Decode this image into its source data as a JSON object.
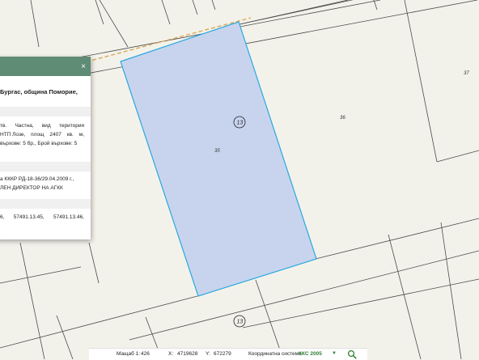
{
  "map": {
    "parcel_labels": [
      {
        "id": "parcel-35",
        "text": "35"
      },
      {
        "id": "parcel-36",
        "text": "36"
      },
      {
        "id": "parcel-37",
        "text": "37"
      }
    ],
    "circle_labels": [
      {
        "id": "upper",
        "text": "13"
      },
      {
        "id": "lower",
        "text": "13"
      }
    ],
    "colors": {
      "background": "#f3f2ea",
      "boundary": "#4a4a4a",
      "selected_fill": "#c8d4ee",
      "selected_stroke": "#29a8e0",
      "road_dash": "#d9a85a"
    }
  },
  "popup": {
    "close_label": "×",
    "address_line1": "Бургас, община Поморие,",
    "desc_line1": [
      "тв.",
      "Частна,",
      "вид",
      "територия"
    ],
    "desc_line2": [
      "НТП Лозе,",
      "площ",
      "2407",
      "кв.",
      "м,"
    ],
    "desc_line3": "върхове: 5 бр., Брой върхове: 5",
    "order_line1": "а КККР РД-18-36/29.04.2009 г.,",
    "order_line2": "ЛЕН ДИРЕКТОР НА АГКК",
    "neighbors_line": [
      "6,",
      "57491.13.45,",
      "57491.13.46,"
    ]
  },
  "bottom_bar": {
    "scale_label": "Мащаб 1:",
    "scale_value": "426",
    "x_label": "X:",
    "x_value": "4719628",
    "y_label": "Y:",
    "y_value": "672279",
    "coord_system_label": "Координатна система:",
    "coord_system_value": "ККС 2005",
    "dropdown_arrow": "▼",
    "search_icon": "search-icon"
  }
}
